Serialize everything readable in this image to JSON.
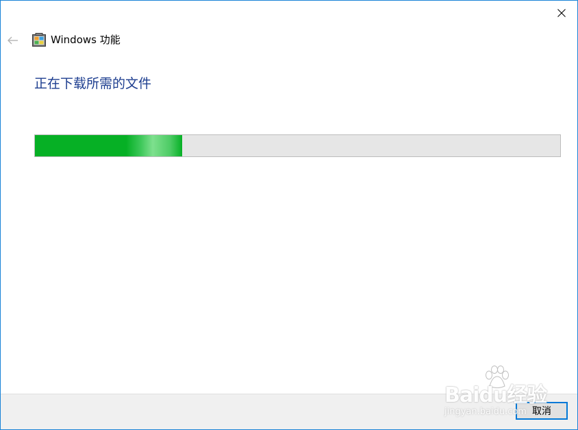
{
  "window": {
    "title": "Windows 功能",
    "close_glyph": "✕",
    "back_glyph": "←",
    "border_color": "#1883d7"
  },
  "content": {
    "heading": "正在下载所需的文件",
    "heading_color": "#1c3d8f",
    "progress": {
      "value": 0.28,
      "fill_color": "#06b025",
      "track_color": "#e6e6e6"
    }
  },
  "footer": {
    "cancel_label": "取消"
  },
  "watermark": {
    "logo_text": "Baidu经验",
    "sub_text": "jingyan.baidu.com"
  },
  "icons": {
    "app": "windows-features-icon",
    "back": "back-arrow-icon",
    "close": "close-icon"
  }
}
